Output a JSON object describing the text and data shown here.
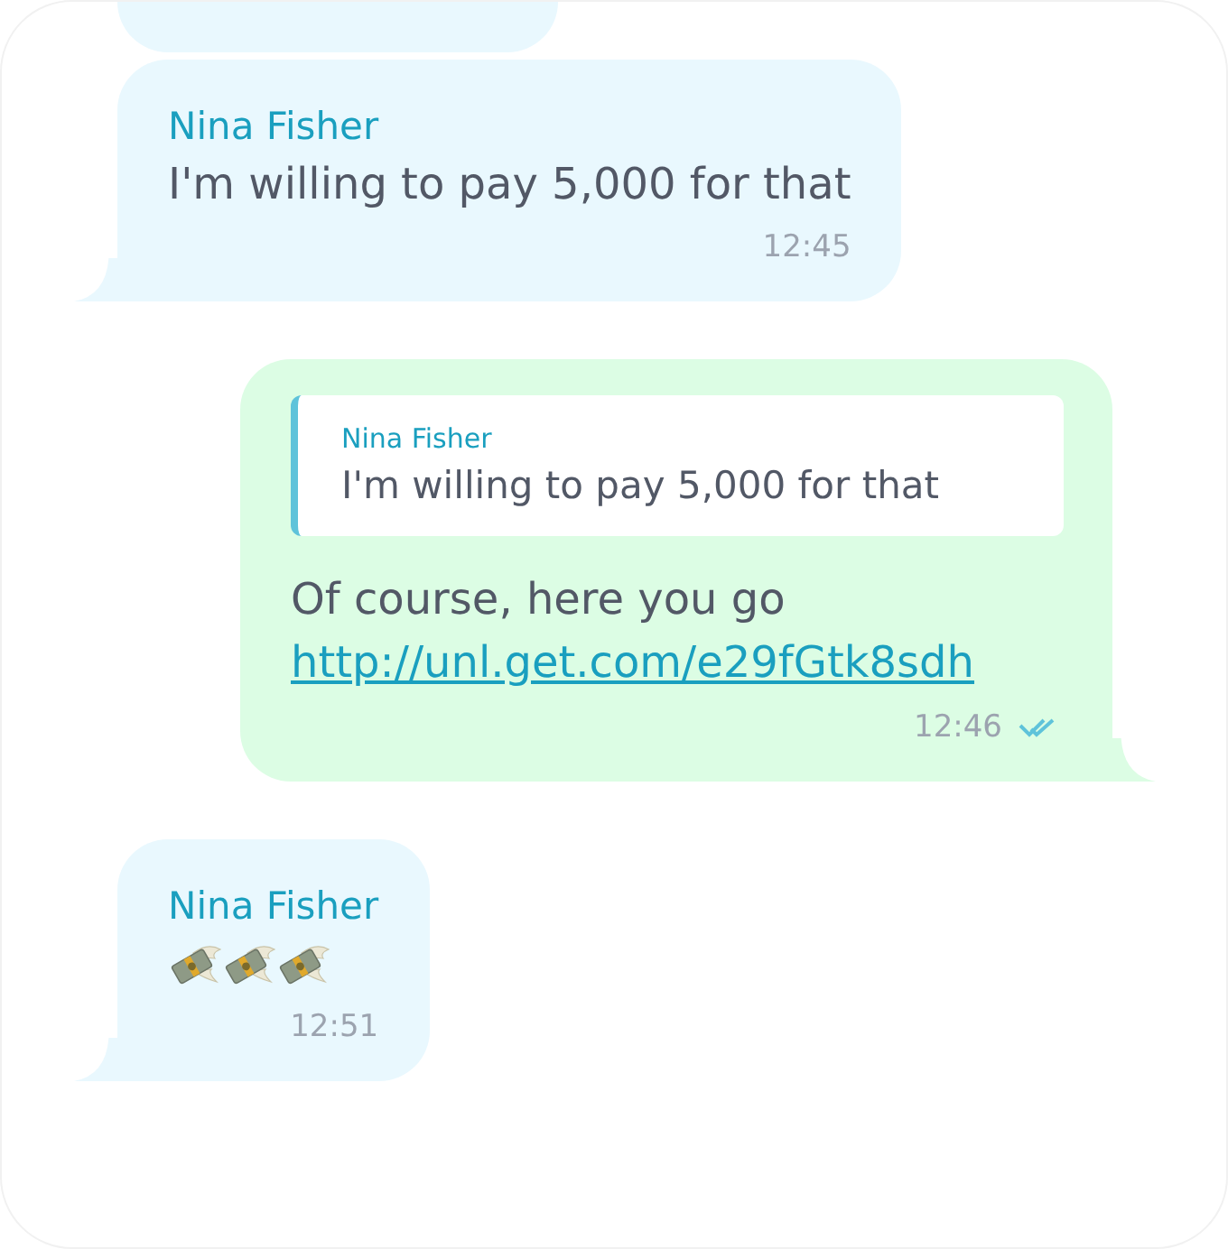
{
  "messages": [
    {
      "kind": "partial",
      "outgoing": false
    },
    {
      "kind": "text",
      "outgoing": false,
      "sender": "Nina Fisher",
      "text": "I'm willing to pay 5,000 for that",
      "time": "12:45"
    },
    {
      "kind": "reply",
      "outgoing": true,
      "quote": {
        "sender": "Nina Fisher",
        "text": "I'm willing to pay 5,000 for that"
      },
      "text": "Of course, here you go",
      "link": "http://unl.get.com/e29fGtk8sdh",
      "time": "12:46",
      "read": true
    },
    {
      "kind": "emoji",
      "outgoing": false,
      "sender": "Nina Fisher",
      "emojis": [
        {
          "kind": "money-wings"
        },
        {
          "kind": "money-wings"
        },
        {
          "kind": "money-wings"
        }
      ],
      "time": "12:51"
    }
  ]
}
